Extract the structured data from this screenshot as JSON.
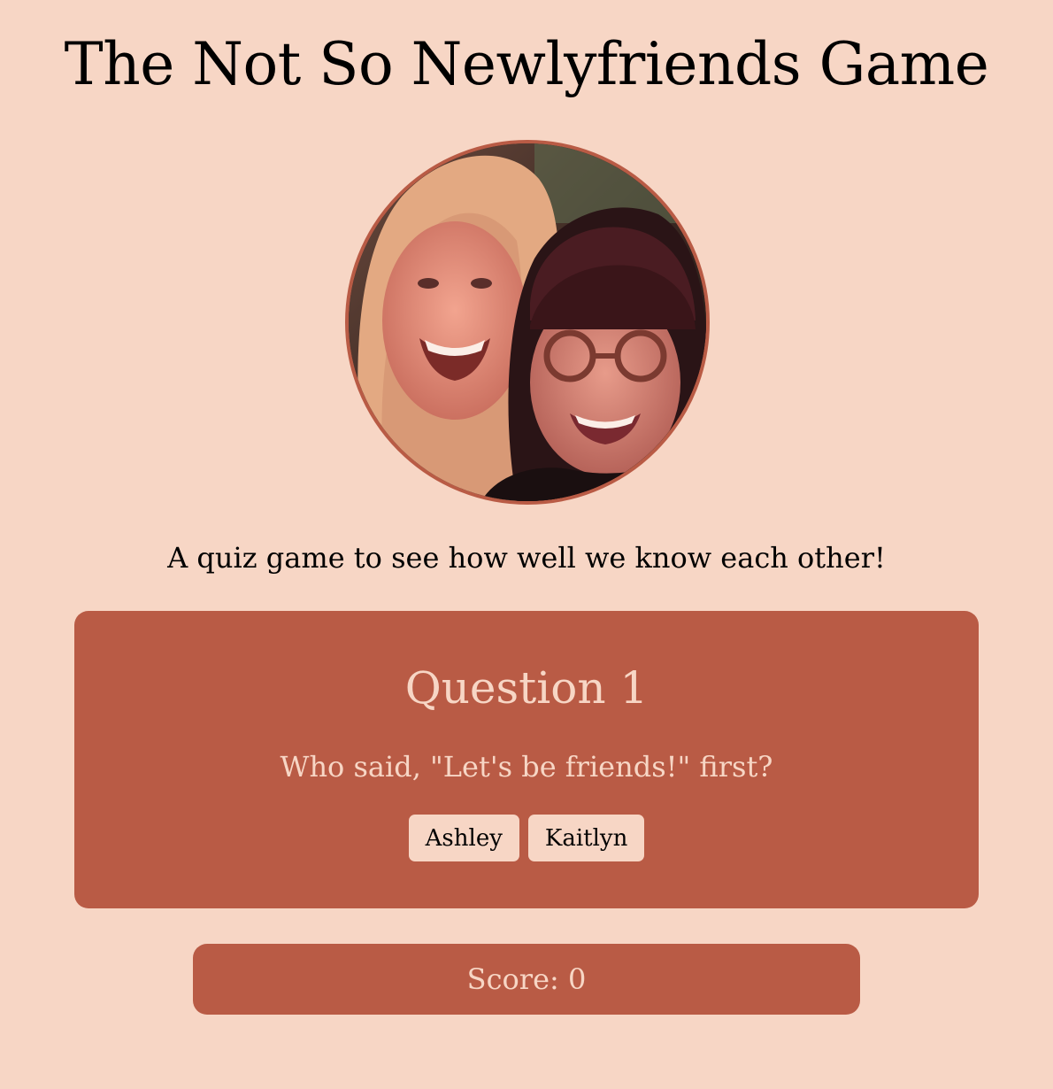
{
  "header": {
    "title": "The Not So Newlyfriends Game"
  },
  "hero": {
    "photo_icon": "friends-photo",
    "tagline": "A quiz game to see how well we know each other!"
  },
  "quiz": {
    "question_title": "Question 1",
    "question_text": "Who said, \"Let's be friends!\" first?",
    "answers": [
      {
        "label": "Ashley"
      },
      {
        "label": "Kaitlyn"
      }
    ]
  },
  "score": {
    "text": "Score: 0"
  },
  "colors": {
    "background": "#f7d6c5",
    "accent": "#b95b45",
    "card_text": "#f7d6c5"
  }
}
